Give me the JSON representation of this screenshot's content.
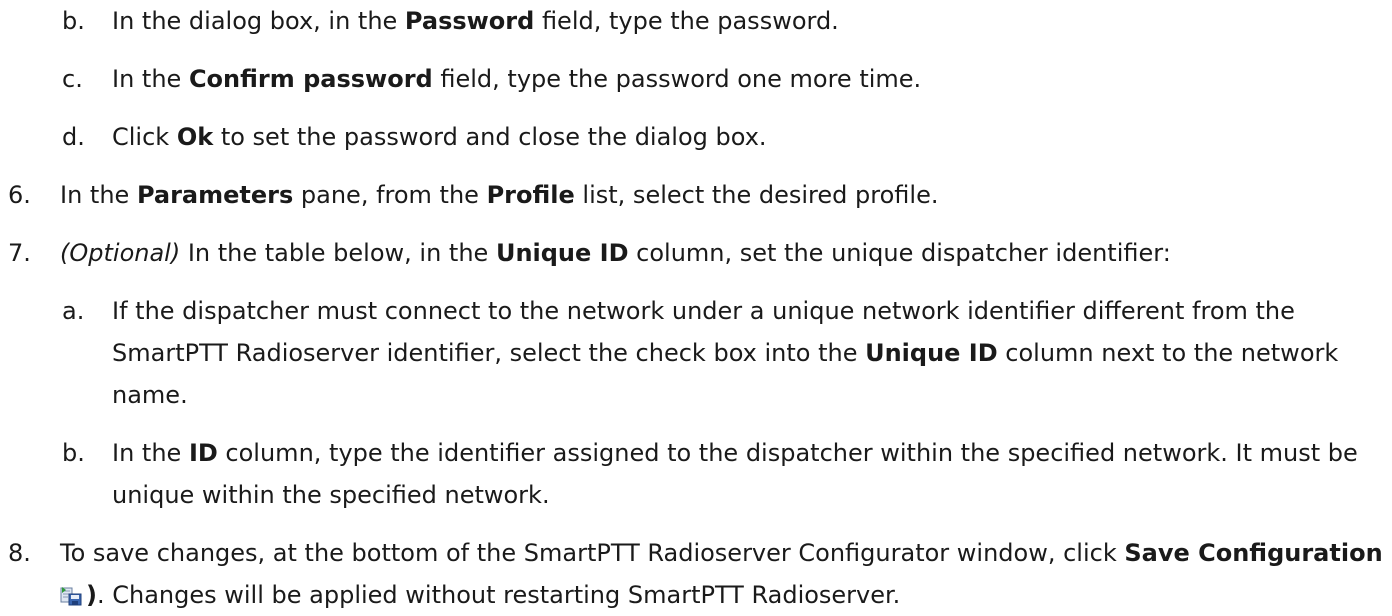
{
  "steps": [
    {
      "marker": "b.",
      "parts": [
        {
          "t": "In the dialog box, in the "
        },
        {
          "t": "Password",
          "b": true
        },
        {
          "t": " field, type the password."
        }
      ]
    },
    {
      "marker": "c.",
      "parts": [
        {
          "t": "In the "
        },
        {
          "t": "Confirm password",
          "b": true
        },
        {
          "t": " field, type the password one more time."
        }
      ]
    },
    {
      "marker": "d.",
      "parts": [
        {
          "t": "Click "
        },
        {
          "t": "Ok",
          "b": true
        },
        {
          "t": " to set the password and close the dialog box."
        }
      ]
    },
    {
      "marker": "6.",
      "parts": [
        {
          "t": "In the "
        },
        {
          "t": "Parameters",
          "b": true
        },
        {
          "t": " pane, from the "
        },
        {
          "t": "Profile",
          "b": true
        },
        {
          "t": " list, select the desired profile."
        }
      ]
    },
    {
      "marker": "7.",
      "parts": [
        {
          "t": "(Optional)",
          "i": true
        },
        {
          "t": " In the table below, in the "
        },
        {
          "t": "Unique ID",
          "b": true
        },
        {
          "t": " column, set the unique dispatcher identifier:"
        }
      ]
    },
    {
      "marker": "a.",
      "lines": [
        [
          {
            "t": "If the dispatcher must connect to the network under a unique network identifier different from the"
          }
        ],
        [
          {
            "t": "SmartPTT Radioserver identifier, select the check box into the "
          },
          {
            "t": "Unique ID",
            "b": true
          },
          {
            "t": " column next to the network"
          }
        ],
        [
          {
            "t": "name."
          }
        ]
      ]
    },
    {
      "marker": "b.",
      "lines": [
        [
          {
            "t": "In the "
          },
          {
            "t": "ID",
            "b": true
          },
          {
            "t": " column, type the identifier assigned to the dispatcher within the specified network. It must be"
          }
        ],
        [
          {
            "t": "unique within the specified network."
          }
        ]
      ]
    },
    {
      "marker": "8.",
      "lines": [
        [
          {
            "t": "To save changes, at the bottom of the SmartPTT Radioserver Configurator window, click "
          },
          {
            "t": "Save Configuration (",
            "b": true
          }
        ],
        [
          {
            "icon": "save-configuration-icon"
          },
          {
            "t": ")",
            "b": true
          },
          {
            "t": ". Changes will be applied without restarting SmartPTT Radioserver."
          }
        ]
      ]
    }
  ]
}
